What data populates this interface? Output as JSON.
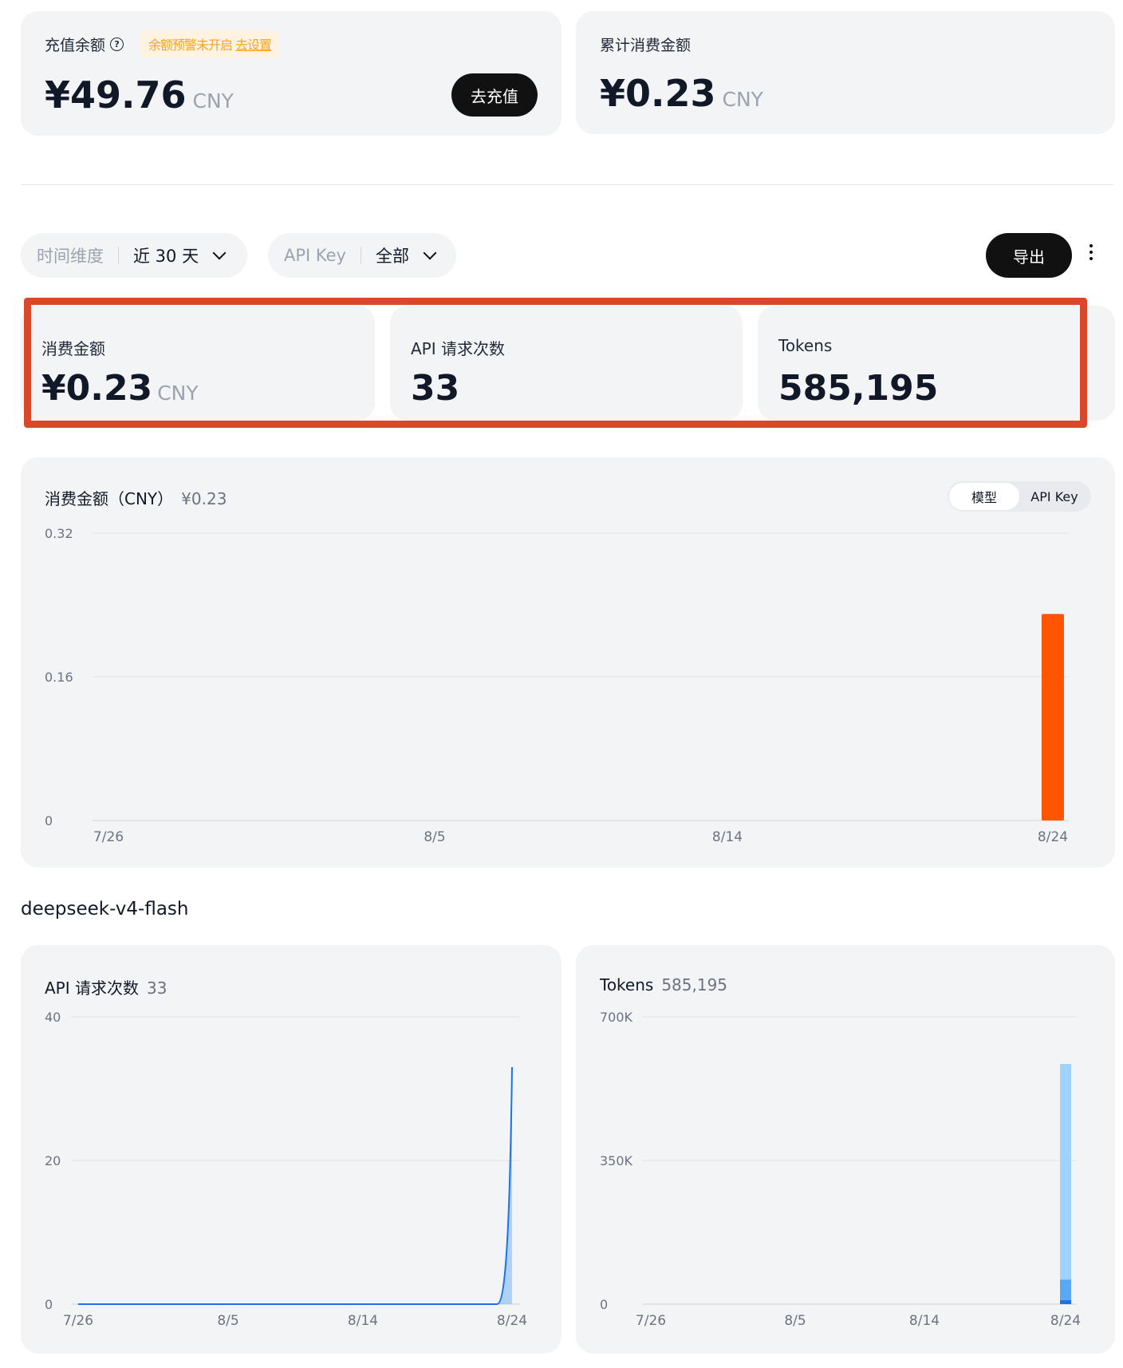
{
  "balance": {
    "label": "充值余额",
    "help_icon": "?",
    "warning_text": "余额预警未开启",
    "warning_link": "去设置",
    "amount": "¥49.76",
    "currency": "CNY",
    "recharge_button": "去充值"
  },
  "total_spend": {
    "label": "累计消费金额",
    "amount": "¥0.23",
    "currency": "CNY"
  },
  "filters": {
    "time_label": "时间维度",
    "time_value": "近 30 天",
    "apikey_label": "API Key",
    "apikey_value": "全部",
    "export_button": "导出"
  },
  "summary": {
    "spend_label": "消费金额",
    "spend_value": "¥0.23",
    "spend_currency": "CNY",
    "requests_label": "API 请求次数",
    "requests_value": "33",
    "tokens_label": "Tokens",
    "tokens_value": "585,195"
  },
  "spend_chart_header": {
    "title": "消费金额（CNY）",
    "total": "¥0.23",
    "toggle_model": "模型",
    "toggle_apikey": "API Key"
  },
  "model_section": {
    "title": "deepseek-v4-flash"
  },
  "requests_chart_header": {
    "title": "API 请求次数",
    "total": "33"
  },
  "tokens_chart_header": {
    "title": "Tokens",
    "total": "585,195"
  },
  "colors": {
    "accent_orange": "#ff5500",
    "line_blue": "#1a73e8",
    "light_blue": "#9ed4fb",
    "highlight_red": "#d9482b"
  },
  "chart_data": [
    {
      "type": "bar",
      "title": "消费金额（CNY）",
      "yticks": [
        "0",
        "0.16",
        "0.32"
      ],
      "ylim": [
        0,
        0.32
      ],
      "xticks": [
        "7/26",
        "8/5",
        "8/14",
        "8/24"
      ],
      "xlim": [
        "7/26",
        "8/24"
      ],
      "bars": [
        {
          "x": "8/24",
          "value": 0.23
        }
      ]
    },
    {
      "type": "area",
      "title": "API 请求次数",
      "yticks": [
        "0",
        "20",
        "40"
      ],
      "ylim": [
        0,
        40
      ],
      "xticks": [
        "7/26",
        "8/5",
        "8/14",
        "8/24"
      ],
      "xlim": [
        "7/26",
        "8/24"
      ],
      "points": [
        {
          "x": "7/26",
          "y": 0
        },
        {
          "x": "8/23",
          "y": 0
        },
        {
          "x": "8/24",
          "y": 33
        }
      ]
    },
    {
      "type": "bar",
      "title": "Tokens",
      "yticks": [
        "0",
        "350K",
        "700K"
      ],
      "ylim": [
        0,
        700000
      ],
      "xticks": [
        "7/26",
        "8/5",
        "8/14",
        "8/24"
      ],
      "xlim": [
        "7/26",
        "8/24"
      ],
      "stacked": [
        {
          "x": "8/24",
          "segments": [
            10000,
            50000,
            525195
          ]
        }
      ]
    }
  ]
}
